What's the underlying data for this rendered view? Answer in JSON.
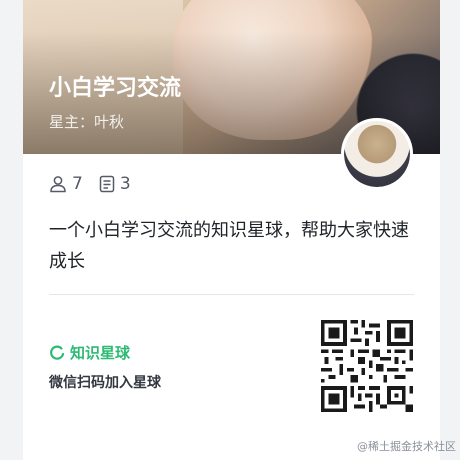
{
  "circle": {
    "title": "小白学习交流",
    "owner": "星主：叶秋",
    "members_count": "7",
    "topics_count": "3",
    "description": "一个小白学习交流的知识星球，帮助大家快速成长"
  },
  "footer": {
    "brand": "知识星球",
    "scan_prompt": "微信扫码加入星球"
  },
  "watermark": "@稀土掘金技术社区",
  "colors": {
    "brand_green": "#2dbb74",
    "text_primary": "#1f2329",
    "text_secondary": "#555a66"
  },
  "icons": {
    "members": "user-icon",
    "topics": "document-icon",
    "brand": "planet-logo-icon"
  }
}
